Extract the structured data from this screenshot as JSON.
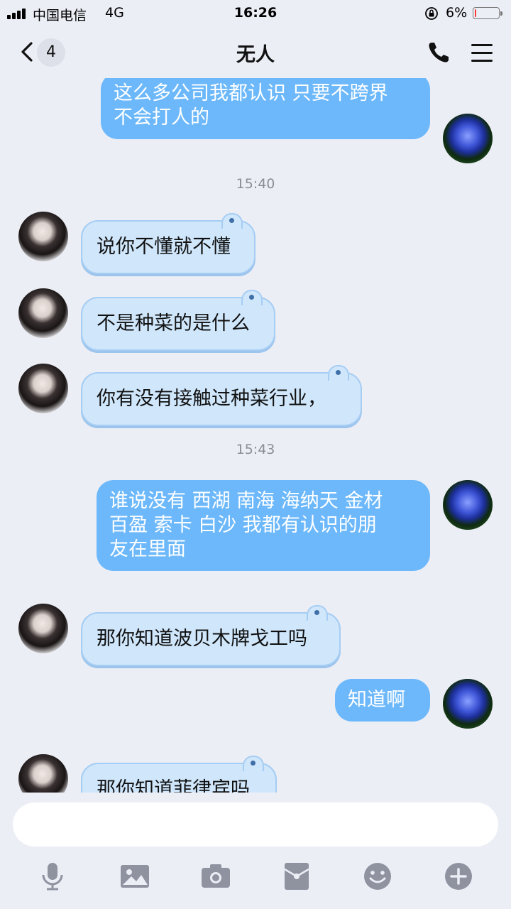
{
  "status": {
    "carrier": "中国电信",
    "network": "4G",
    "time": "16:26",
    "battery_pct": "6%",
    "battery_level": 0.06
  },
  "header": {
    "unread_count": "4",
    "title": "无人"
  },
  "messages": [
    {
      "side": "out",
      "text": "这么多公司我都认识 只要不跨界\n不会打人的"
    },
    {
      "type": "time",
      "text": "15:40"
    },
    {
      "side": "in",
      "text": "说你不懂就不懂"
    },
    {
      "side": "in",
      "text": "不是种菜的是什么"
    },
    {
      "side": "in",
      "text": "你有没有接触过种菜行业，"
    },
    {
      "type": "time",
      "text": "15:43"
    },
    {
      "side": "out",
      "text": "谁说没有 西湖 南海 海纳天 金材\n百盈 索卡 白沙 我都有认识的朋\n友在里面"
    },
    {
      "side": "in",
      "text": "那你知道波贝木牌戈工吗"
    },
    {
      "side": "out",
      "text": "知道啊"
    },
    {
      "side": "in",
      "text": "那你知道菲律宾吗"
    }
  ],
  "input": {
    "value": "",
    "placeholder": ""
  },
  "toolbar": [
    "microphone-icon",
    "image-icon",
    "camera-icon",
    "red-packet-icon",
    "emoji-icon",
    "plus-icon"
  ],
  "colors": {
    "background": "#eceef6",
    "outgoing_bubble": "#6cb8fb",
    "incoming_bubble": "#cfe6fb",
    "battery_low": "#ff3b30",
    "icon_gray": "#8f93a0"
  }
}
